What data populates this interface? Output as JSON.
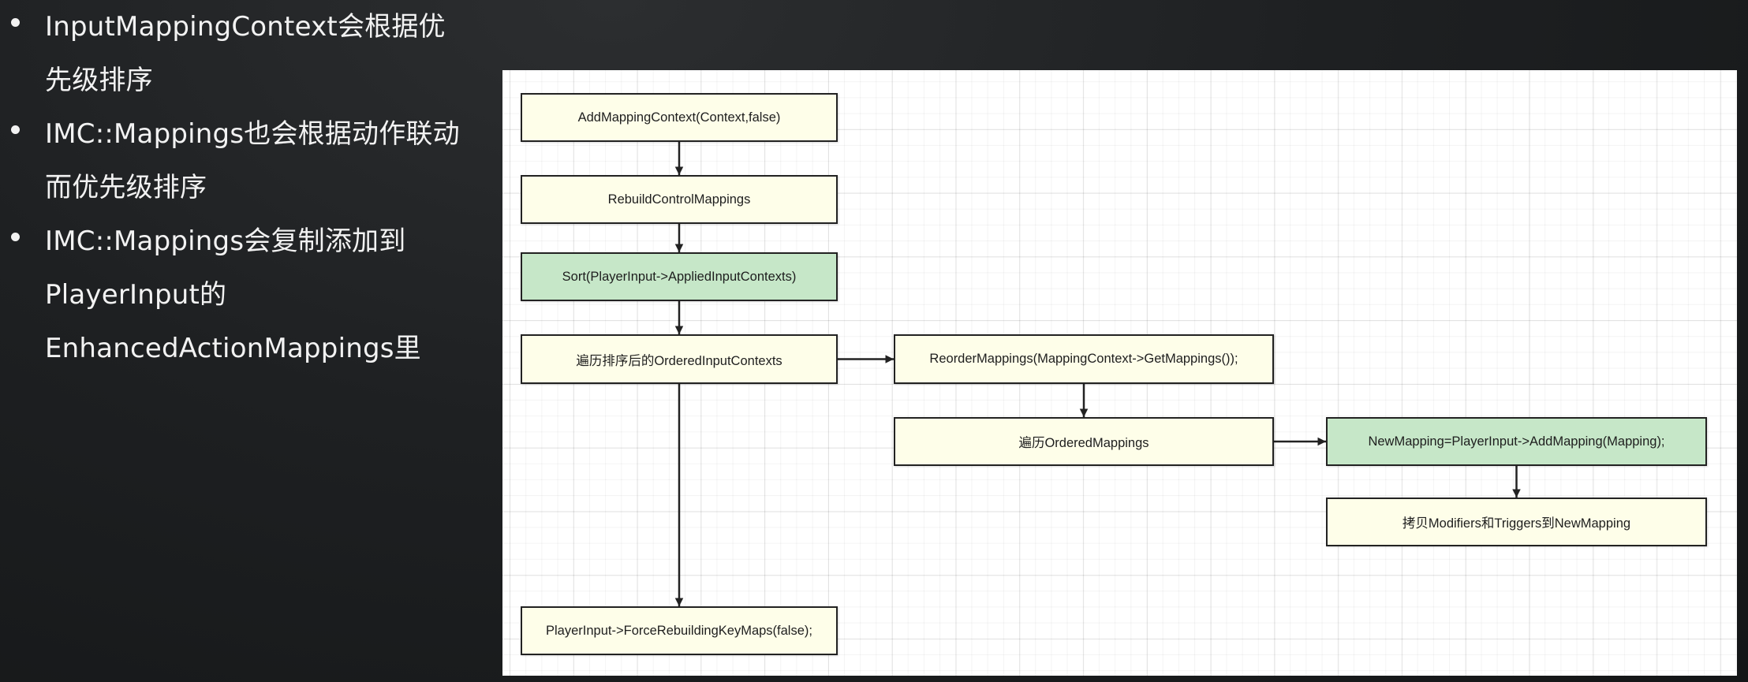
{
  "notes": [
    {
      "lines": [
        "InputMappingContext会根据优",
        "先级排序"
      ]
    },
    {
      "lines": [
        "IMC::Mappings也会根据动作联动",
        "而优先级排序"
      ]
    },
    {
      "lines": [
        "IMC::Mappings会复制添加到",
        "PlayerInput的",
        "EnhancedActionMappings里"
      ]
    }
  ],
  "diagram": {
    "colors": {
      "process": "#fefee9",
      "highlight": "#c6e7c8",
      "stroke": "#222222"
    },
    "nodes": [
      {
        "id": "add-mapping-context",
        "label": "AddMappingContext(Context,false)",
        "style": "process"
      },
      {
        "id": "rebuild-control-mappings",
        "label": "RebuildControlMappings",
        "style": "process"
      },
      {
        "id": "sort-applied-input-contexts",
        "label": "Sort(PlayerInput->AppliedInputContexts)",
        "style": "highlight"
      },
      {
        "id": "iterate-ordered-input-contexts",
        "label": "遍历排序后的OrderedInputContexts",
        "style": "process"
      },
      {
        "id": "reorder-mappings",
        "label": "ReorderMappings(MappingContext->GetMappings());",
        "style": "process"
      },
      {
        "id": "iterate-ordered-mappings",
        "label": "遍历OrderedMappings",
        "style": "process"
      },
      {
        "id": "add-mapping",
        "label": "NewMapping=PlayerInput->AddMapping(Mapping);",
        "style": "highlight"
      },
      {
        "id": "copy-modifiers-triggers",
        "label": "拷贝Modifiers和Triggers到NewMapping",
        "style": "process"
      },
      {
        "id": "force-rebuilding-key-maps",
        "label": "PlayerInput->ForceRebuildingKeyMaps(false);",
        "style": "process"
      }
    ],
    "edges": [
      {
        "from": "add-mapping-context",
        "to": "rebuild-control-mappings"
      },
      {
        "from": "rebuild-control-mappings",
        "to": "sort-applied-input-contexts"
      },
      {
        "from": "sort-applied-input-contexts",
        "to": "iterate-ordered-input-contexts"
      },
      {
        "from": "iterate-ordered-input-contexts",
        "to": "reorder-mappings"
      },
      {
        "from": "reorder-mappings",
        "to": "iterate-ordered-mappings"
      },
      {
        "from": "iterate-ordered-mappings",
        "to": "add-mapping"
      },
      {
        "from": "add-mapping",
        "to": "copy-modifiers-triggers"
      },
      {
        "from": "iterate-ordered-input-contexts",
        "to": "force-rebuilding-key-maps"
      }
    ]
  }
}
